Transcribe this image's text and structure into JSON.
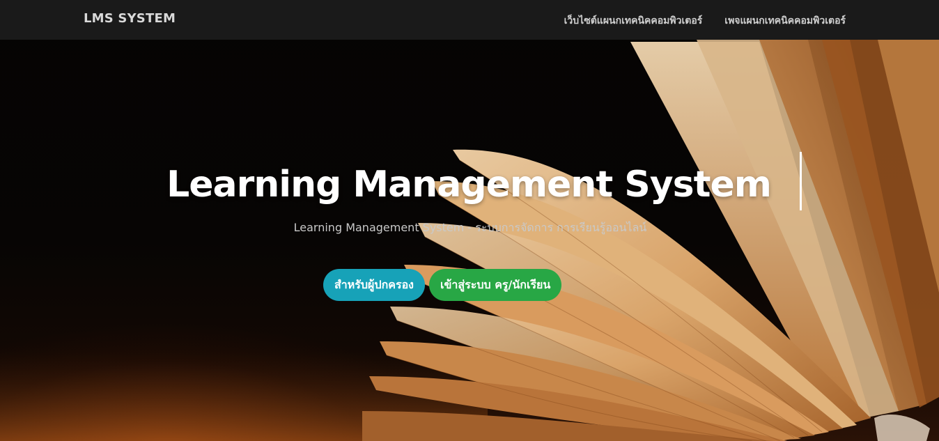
{
  "navbar": {
    "brand": "LMS SYSTEM",
    "links": [
      "เว็บไซต์แผนกเทคนิคคอมพิวเตอร์",
      "เพจแผนกเทคนิคคอมพิวเตอร์"
    ]
  },
  "hero": {
    "title": "Learning Management System",
    "subtitle": "Learning Management System - ระบบการจัดการ การเรียนรู้ออนไลน์",
    "buttons": [
      "สำหรับผู้ปกครอง",
      "เข้าสู่ระบบ ครู/นักเรียน"
    ],
    "background": "open-book-photo"
  },
  "colors": {
    "navbar_bg": "#1c1c1c",
    "parent_button": "#17a2b8",
    "login_button": "#28a745",
    "title_text": "#ffffff"
  }
}
